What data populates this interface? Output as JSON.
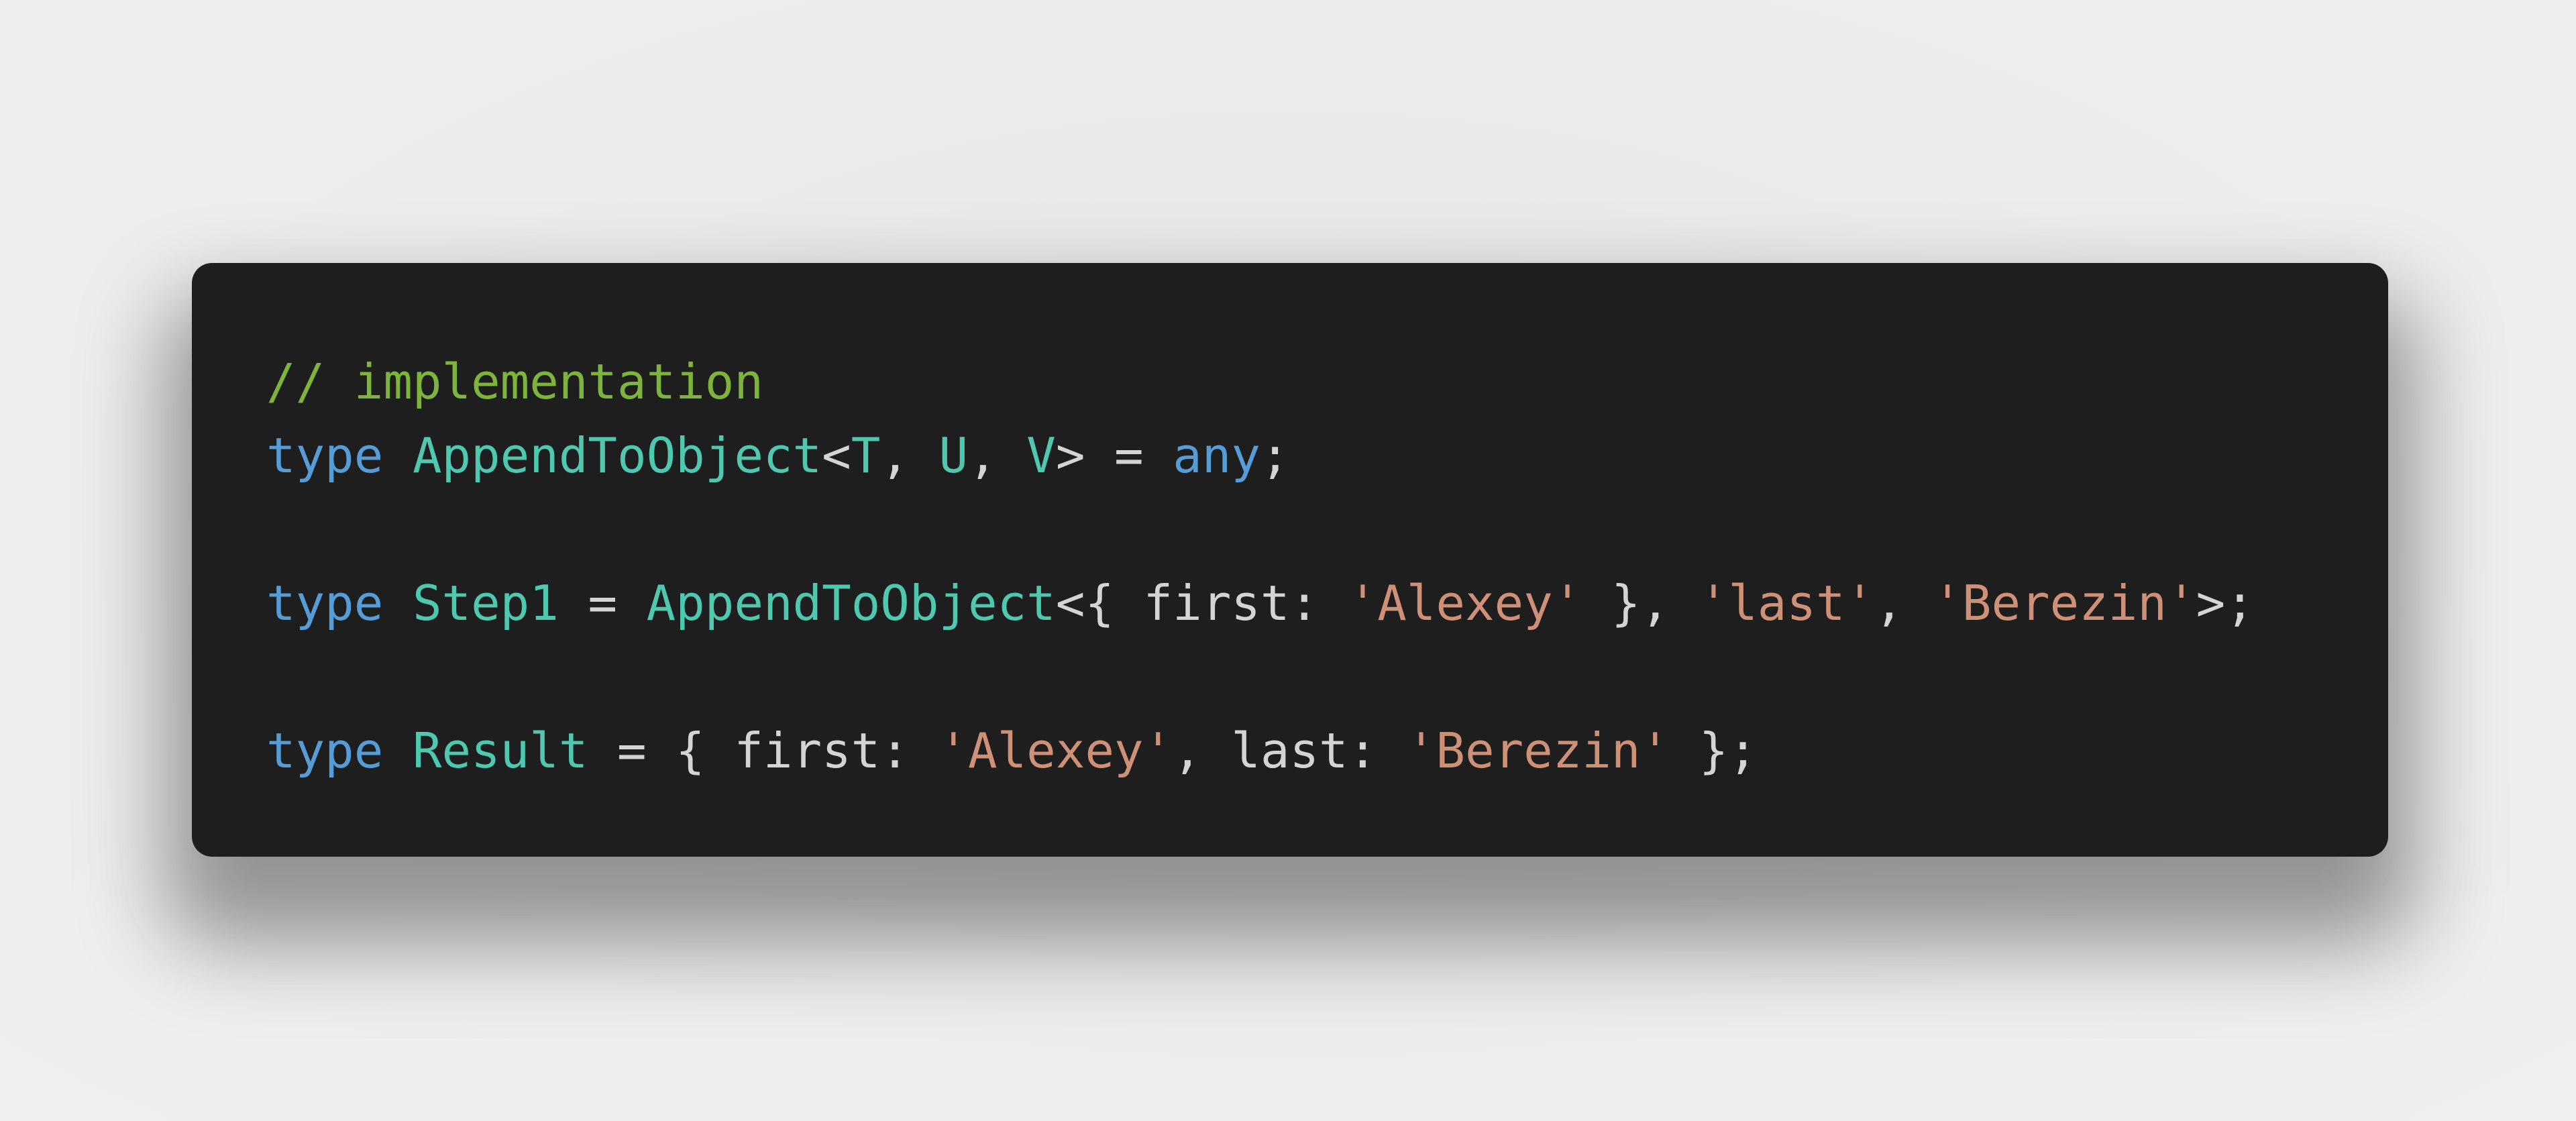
{
  "theme": {
    "background": "#1e1e1e",
    "comment": "#7fb43c",
    "keyword": "#569cd6",
    "type": "#4ec9b0",
    "string": "#ce9178",
    "punct": "#d4d4d4"
  },
  "code": {
    "language": "typescript",
    "lines": [
      {
        "tokens": [
          {
            "kind": "comment",
            "text": "// implementation"
          }
        ]
      },
      {
        "tokens": [
          {
            "kind": "keyword",
            "text": "type"
          },
          {
            "kind": "plain",
            "text": " "
          },
          {
            "kind": "type",
            "text": "AppendToObject"
          },
          {
            "kind": "punct",
            "text": "<"
          },
          {
            "kind": "type",
            "text": "T"
          },
          {
            "kind": "punct",
            "text": ", "
          },
          {
            "kind": "type",
            "text": "U"
          },
          {
            "kind": "punct",
            "text": ", "
          },
          {
            "kind": "type",
            "text": "V"
          },
          {
            "kind": "punct",
            "text": "> = "
          },
          {
            "kind": "keyword",
            "text": "any"
          },
          {
            "kind": "punct",
            "text": ";"
          }
        ]
      },
      {
        "tokens": []
      },
      {
        "tokens": [
          {
            "kind": "keyword",
            "text": "type"
          },
          {
            "kind": "plain",
            "text": " "
          },
          {
            "kind": "type",
            "text": "Step1"
          },
          {
            "kind": "punct",
            "text": " = "
          },
          {
            "kind": "type",
            "text": "AppendToObject"
          },
          {
            "kind": "punct",
            "text": "<{ first: "
          },
          {
            "kind": "string",
            "text": "'Alexey'"
          },
          {
            "kind": "punct",
            "text": " }, "
          },
          {
            "kind": "string",
            "text": "'last'"
          },
          {
            "kind": "punct",
            "text": ", "
          },
          {
            "kind": "string",
            "text": "'Berezin'"
          },
          {
            "kind": "punct",
            "text": ">;"
          }
        ]
      },
      {
        "tokens": []
      },
      {
        "tokens": [
          {
            "kind": "keyword",
            "text": "type"
          },
          {
            "kind": "plain",
            "text": " "
          },
          {
            "kind": "type",
            "text": "Result"
          },
          {
            "kind": "punct",
            "text": " = { first: "
          },
          {
            "kind": "string",
            "text": "'Alexey'"
          },
          {
            "kind": "punct",
            "text": ", last: "
          },
          {
            "kind": "string",
            "text": "'Berezin'"
          },
          {
            "kind": "punct",
            "text": " };"
          }
        ]
      }
    ]
  }
}
